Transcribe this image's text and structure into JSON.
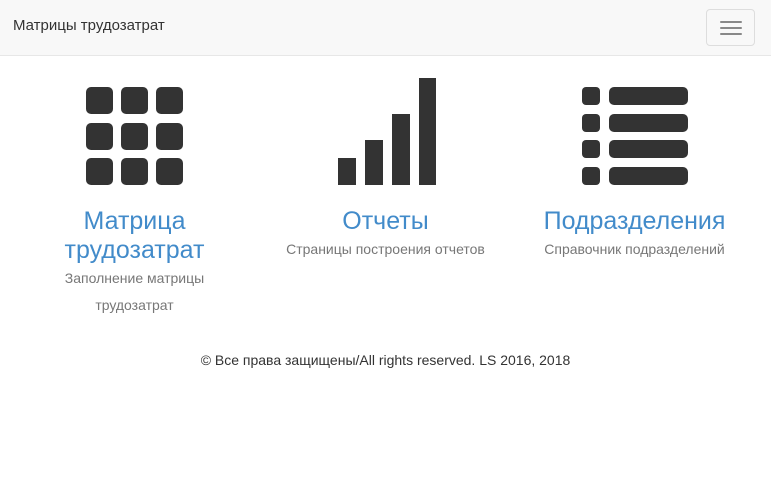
{
  "navbar": {
    "brand": "Матрицы трудозатрат",
    "toggle_icon": "hamburger-menu-icon"
  },
  "tiles": [
    {
      "icon": "grid-icon",
      "title_line1": "Матрица",
      "title_line2": "трудозатрат",
      "desc_line1": "Заполнение матрицы",
      "desc_line2": "трудозатрат"
    },
    {
      "icon": "bar-chart-icon",
      "title": "Отчеты",
      "desc": "Страницы построения отчетов"
    },
    {
      "icon": "list-icon",
      "title": "Подразделения",
      "desc": "Справочник подразделений"
    }
  ],
  "footer": {
    "text": "© Все права защищены/All rights reserved. LS 2016, 2018"
  },
  "colors": {
    "link": "#428bca",
    "icon": "#333333",
    "muted": "#777777",
    "navbar_bg": "#f8f8f8"
  }
}
